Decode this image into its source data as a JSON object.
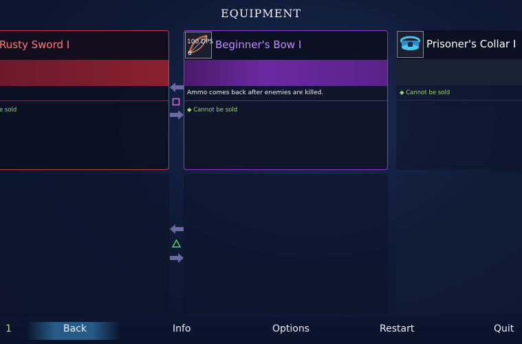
{
  "screen": {
    "title": "EQUIPMENT"
  },
  "items": {
    "left": {
      "name": "Rusty Sword I",
      "note": "e sold",
      "name_color": "#ff7a7a",
      "accent": "#c23c4e"
    },
    "center": {
      "name": "Beginner's Bow I",
      "level": "6",
      "stat": "100 DPS",
      "description": "Ammo comes back after enemies are killed.",
      "note": "Cannot be sold",
      "name_color": "#c48aff",
      "accent": "#8a3cc4",
      "icon": "bow-icon"
    },
    "right": {
      "name": "Prisoner's Collar I",
      "note": "Cannot be sold",
      "name_color": "#ffffff",
      "icon": "collar-icon"
    }
  },
  "controls": {
    "swap_top_icon": "square-button-icon",
    "swap_bottom_icon": "triangle-button-icon"
  },
  "menu": {
    "index": "1",
    "back": "Back",
    "info": "Info",
    "options": "Options",
    "restart": "Restart",
    "quit": "Quit"
  }
}
